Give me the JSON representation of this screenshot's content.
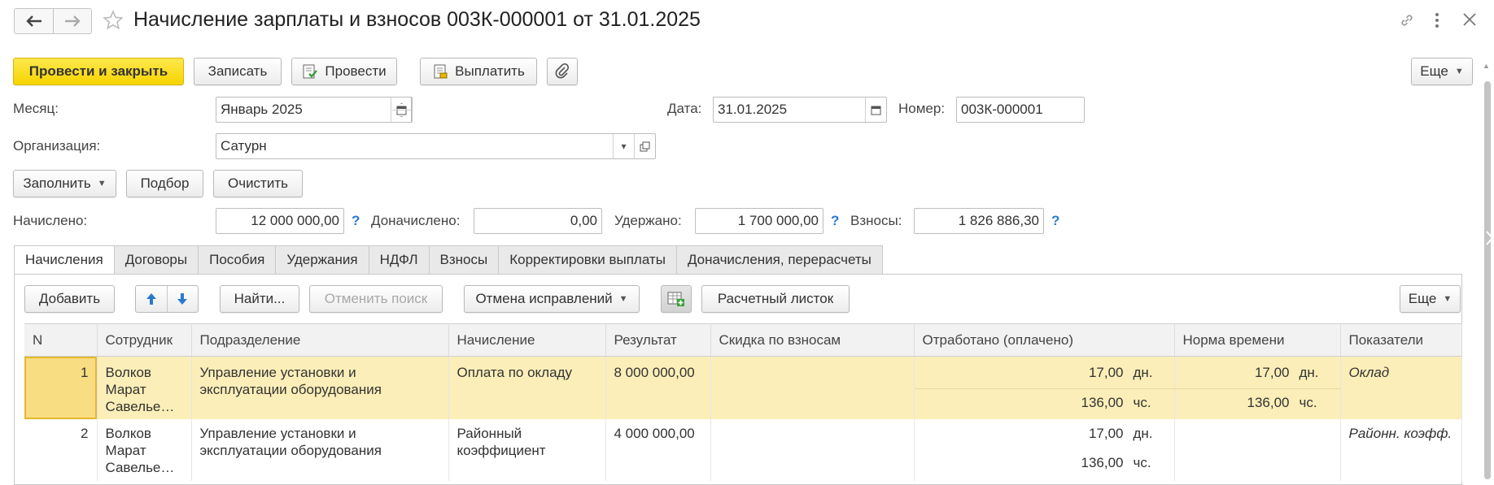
{
  "header": {
    "title": "Начисление зарплаты и взносов 003К-000001 от 31.01.2025"
  },
  "toolbar": {
    "post_close": "Провести и закрыть",
    "save": "Записать",
    "post": "Провести",
    "pay": "Выплатить",
    "more": "Еще"
  },
  "fields": {
    "month_label": "Месяц:",
    "month_value": "Январь 2025",
    "date_label": "Дата:",
    "date_value": "31.01.2025",
    "number_label": "Номер:",
    "number_value": "003К-000001",
    "org_label": "Организация:",
    "org_value": "Сатурн"
  },
  "actions": {
    "fill": "Заполнить",
    "select": "Подбор",
    "clear": "Очистить"
  },
  "totals": {
    "accrued_label": "Начислено:",
    "accrued_value": "12 000 000,00",
    "additional_label": "Доначислено:",
    "additional_value": "0,00",
    "withheld_label": "Удержано:",
    "withheld_value": "1 700 000,00",
    "contrib_label": "Взносы:",
    "contrib_value": "1 826 886,30",
    "help": "?"
  },
  "tabs": [
    {
      "label": "Начисления"
    },
    {
      "label": "Договоры"
    },
    {
      "label": "Пособия"
    },
    {
      "label": "Удержания"
    },
    {
      "label": "НДФЛ"
    },
    {
      "label": "Взносы"
    },
    {
      "label": "Корректировки выплаты"
    },
    {
      "label": "Доначисления, перерасчеты"
    }
  ],
  "table_toolbar": {
    "add": "Добавить",
    "find": "Найти...",
    "cancel_search": "Отменить поиск",
    "cancel_corrections": "Отмена исправлений",
    "payslip": "Расчетный листок",
    "more": "Еще"
  },
  "table": {
    "columns": [
      "N",
      "Сотрудник",
      "Подразделение",
      "Начисление",
      "Результат",
      "Скидка по взносам",
      "Отработано (оплачено)",
      "Норма времени",
      "Показатели"
    ],
    "rows": [
      {
        "n": "1",
        "employee": [
          "Волков",
          "Марат",
          "Савелье…"
        ],
        "department": [
          "Управление установки и",
          "эксплуатации оборудования"
        ],
        "accrual": [
          "Оплата по окладу"
        ],
        "result": "8 000 000,00",
        "discount": "",
        "worked_days": "17,00",
        "worked_days_unit": "дн.",
        "worked_hours": "136,00",
        "worked_hours_unit": "чс.",
        "norm_days": "17,00",
        "norm_days_unit": "дн.",
        "norm_hours": "136,00",
        "norm_hours_unit": "чс.",
        "indicators": "Оклад"
      },
      {
        "n": "2",
        "employee": [
          "Волков",
          "Марат",
          "Савелье…"
        ],
        "department": [
          "Управление установки и",
          "эксплуатации оборудования"
        ],
        "accrual": [
          "Районный",
          "коэффициент"
        ],
        "result": "4 000 000,00",
        "discount": "",
        "worked_days": "17,00",
        "worked_days_unit": "дн.",
        "worked_hours": "136,00",
        "worked_hours_unit": "чс.",
        "norm_days": "",
        "norm_days_unit": "",
        "norm_hours": "",
        "norm_hours_unit": "",
        "indicators": "Районн. коэфф."
      }
    ]
  },
  "colors": {
    "primary_button": "#f5d400",
    "selected_row": "#fbeeb8",
    "help_mark": "#2a7ad0"
  }
}
